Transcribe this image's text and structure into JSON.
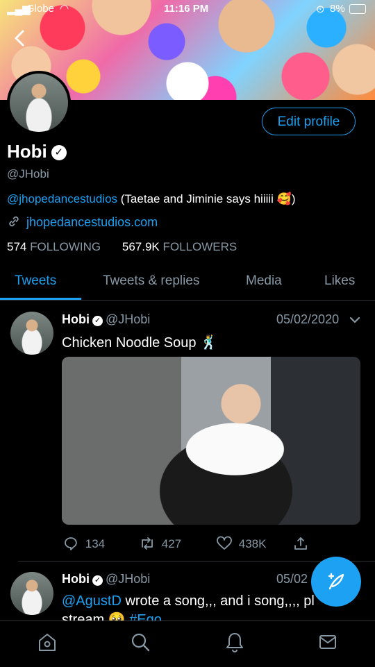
{
  "status_bar": {
    "carrier": "Globe",
    "time": "11:16 PM",
    "battery": "8%"
  },
  "profile": {
    "name": "Hobi",
    "handle": "@JHobi",
    "edit_button": "Edit profile",
    "bio_mention": "@jhopedancestudios",
    "bio_text": " (Taetae and Jiminie says hiiiii 🥰)",
    "website": "jhopedancestudios.com",
    "following_count": "574",
    "following_label": "FOLLOWING",
    "followers_count": "567.9K",
    "followers_label": "FOLLOWERS"
  },
  "tabs": [
    {
      "label": "Tweets",
      "active": true
    },
    {
      "label": "Tweets & replies",
      "active": false
    },
    {
      "label": "Media",
      "active": false
    },
    {
      "label": "Likes",
      "active": false
    }
  ],
  "tweets": [
    {
      "name": "Hobi",
      "handle": "@JHobi",
      "date": "05/02/2020",
      "text": "Chicken Noodle Soup 🕺",
      "replies": "134",
      "retweets": "427",
      "likes": "438K"
    },
    {
      "name": "Hobi",
      "handle": "@JHobi",
      "date": "05/02",
      "mention": "@AgustD",
      "text": " wrote a song,,, and i song,,,, pl",
      "text2": "stream 🥺 ",
      "hashtag": "#Ego"
    }
  ],
  "icons": {
    "back": "chevron-left-icon",
    "home": "home-icon",
    "search": "search-icon",
    "notifications": "bell-icon",
    "messages": "mail-icon",
    "compose": "compose-icon"
  },
  "colors": {
    "accent": "#1da1f2",
    "background": "#000000",
    "muted": "#8899a6"
  }
}
